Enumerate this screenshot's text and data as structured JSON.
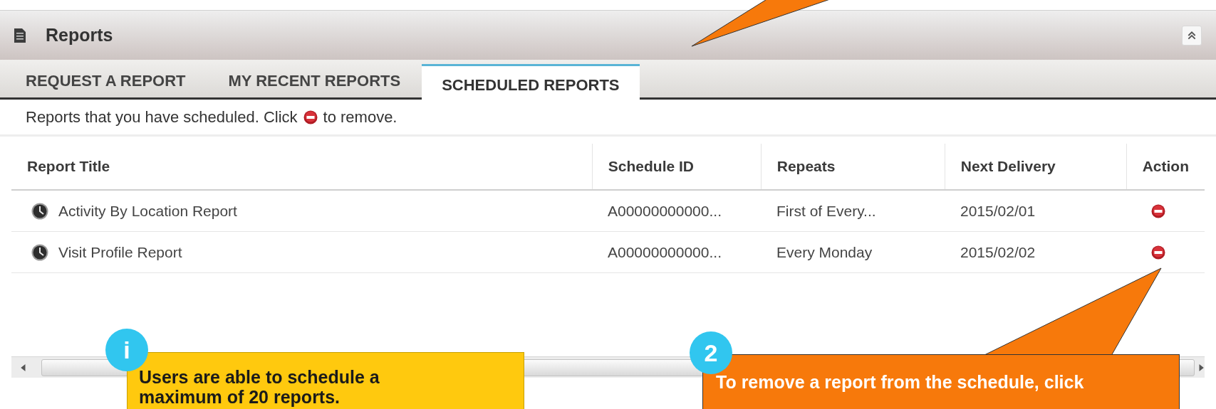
{
  "panel": {
    "title": "Reports"
  },
  "tabs": [
    {
      "label": "REQUEST A REPORT",
      "selected": false
    },
    {
      "label": "MY RECENT REPORTS",
      "selected": false
    },
    {
      "label": "SCHEDULED REPORTS",
      "selected": true
    }
  ],
  "intro": {
    "before": "Reports that you have scheduled. Click",
    "after": "to remove."
  },
  "table": {
    "columns": [
      "Report Title",
      "Schedule ID",
      "Repeats",
      "Next Delivery",
      "Action"
    ],
    "rows": [
      {
        "title": "Activity By Location Report",
        "schedule_id": "A00000000000...",
        "repeats": "First of Every...",
        "next_delivery": "2015/02/01"
      },
      {
        "title": "Visit Profile Report",
        "schedule_id": "A00000000000...",
        "repeats": "Every Monday",
        "next_delivery": "2015/02/02"
      }
    ]
  },
  "callouts": [
    {
      "kind": "info",
      "badge": "i",
      "lines": [
        "Users are able to schedule a",
        "maximum of 20 reports."
      ]
    },
    {
      "kind": "step",
      "badge": "2",
      "lines": [
        "To remove a report from the schedule, click"
      ]
    }
  ]
}
